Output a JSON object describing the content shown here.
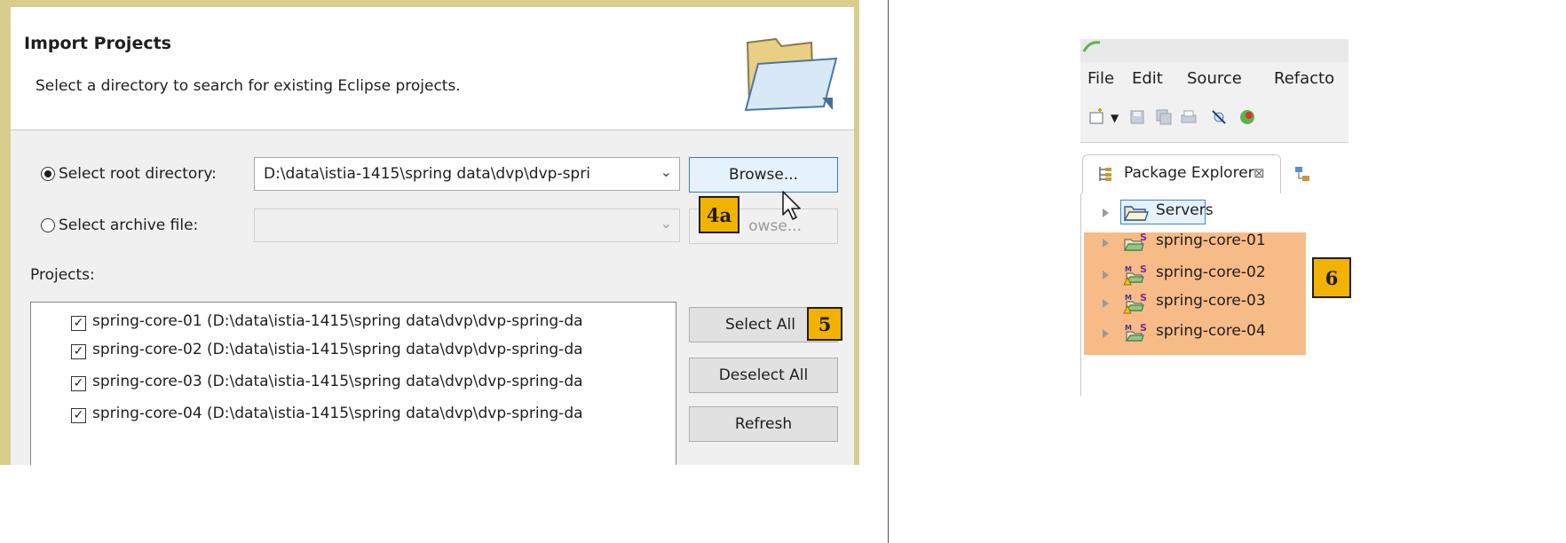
{
  "dialog": {
    "title": "Import Projects",
    "subtitle": "Select a directory to search for existing Eclipse projects.",
    "root_option_label": "Select root directory:",
    "root_path": "D:\\data\\istia-1415\\spring data\\dvp\\dvp-spri",
    "browse_label": "Browse...",
    "archive_option_label": "Select archive file:",
    "archive_browse_label": "owse...",
    "projects_label": "Projects:",
    "projects": [
      {
        "label": "spring-core-01 (D:\\data\\istia-1415\\spring data\\dvp\\dvp-spring-da",
        "checked": "✓"
      },
      {
        "label": "spring-core-02 (D:\\data\\istia-1415\\spring data\\dvp\\dvp-spring-da",
        "checked": "✓"
      },
      {
        "label": "spring-core-03 (D:\\data\\istia-1415\\spring data\\dvp\\dvp-spring-da",
        "checked": "✓"
      },
      {
        "label": "spring-core-04 (D:\\data\\istia-1415\\spring data\\dvp\\dvp-spring-da",
        "checked": "✓"
      }
    ],
    "select_all_label": "Select All",
    "deselect_all_label": "Deselect All",
    "refresh_label": "Refresh"
  },
  "callouts": {
    "browse": "4a",
    "select_all": "5",
    "explorer": "6"
  },
  "eclipse": {
    "menu": [
      "File",
      "Edit",
      "Source",
      "Refacto"
    ],
    "tab_label": "Package Explorer",
    "tab_close": "⊠",
    "tree": [
      {
        "label": "Servers",
        "icon": "folder-icon"
      },
      {
        "label": "spring-core-01",
        "icon": "spring-project-icon"
      },
      {
        "label": "spring-core-02",
        "icon": "maven-spring-warning-icon"
      },
      {
        "label": "spring-core-03",
        "icon": "maven-spring-warning-icon"
      },
      {
        "label": "spring-core-04",
        "icon": "maven-spring-project-icon"
      }
    ]
  },
  "colors": {
    "callout": "#f2b200",
    "highlight": "#f7bb88",
    "dialog_frame": "#d9cd8d"
  }
}
